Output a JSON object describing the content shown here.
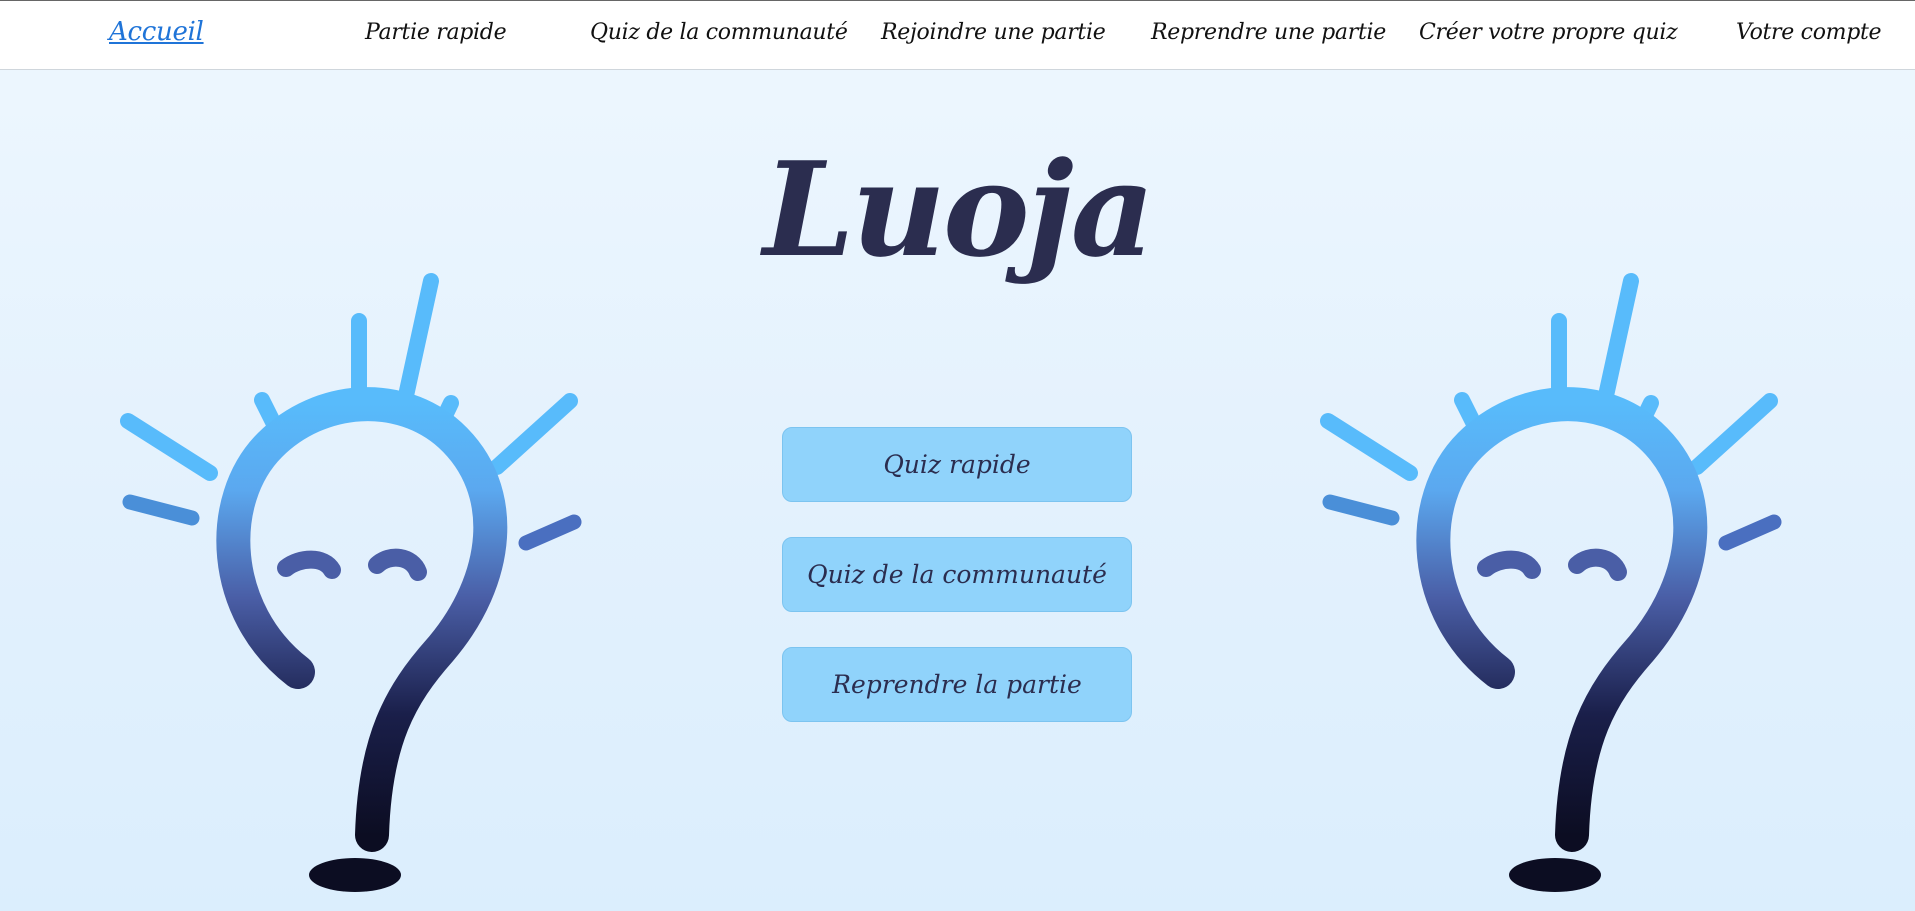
{
  "nav": {
    "items": [
      {
        "label": "Accueil",
        "active": true
      },
      {
        "label": "Partie rapide"
      },
      {
        "label": "Quiz de la communauté"
      },
      {
        "label": "Rejoindre une partie"
      },
      {
        "label": "Reprendre une partie"
      },
      {
        "label": "Créer votre propre quiz"
      },
      {
        "label": "Votre compte"
      }
    ]
  },
  "hero": {
    "title": "Luoja"
  },
  "menu": {
    "buttons": [
      {
        "label": "Quiz rapide"
      },
      {
        "label": "Quiz de la communauté"
      },
      {
        "label": "Reprendre la partie"
      }
    ]
  },
  "illustrations": {
    "left_icon": "lightbulb-question-icon",
    "right_icon": "lightbulb-question-icon"
  },
  "colors": {
    "active_link": "#1f74d8",
    "button_bg": "#90d3fb",
    "title_text": "#2b2d4f",
    "bulb_top": "#58bbfb",
    "bulb_mid": "#4a5ea6",
    "bulb_bottom": "#0c0d22"
  }
}
